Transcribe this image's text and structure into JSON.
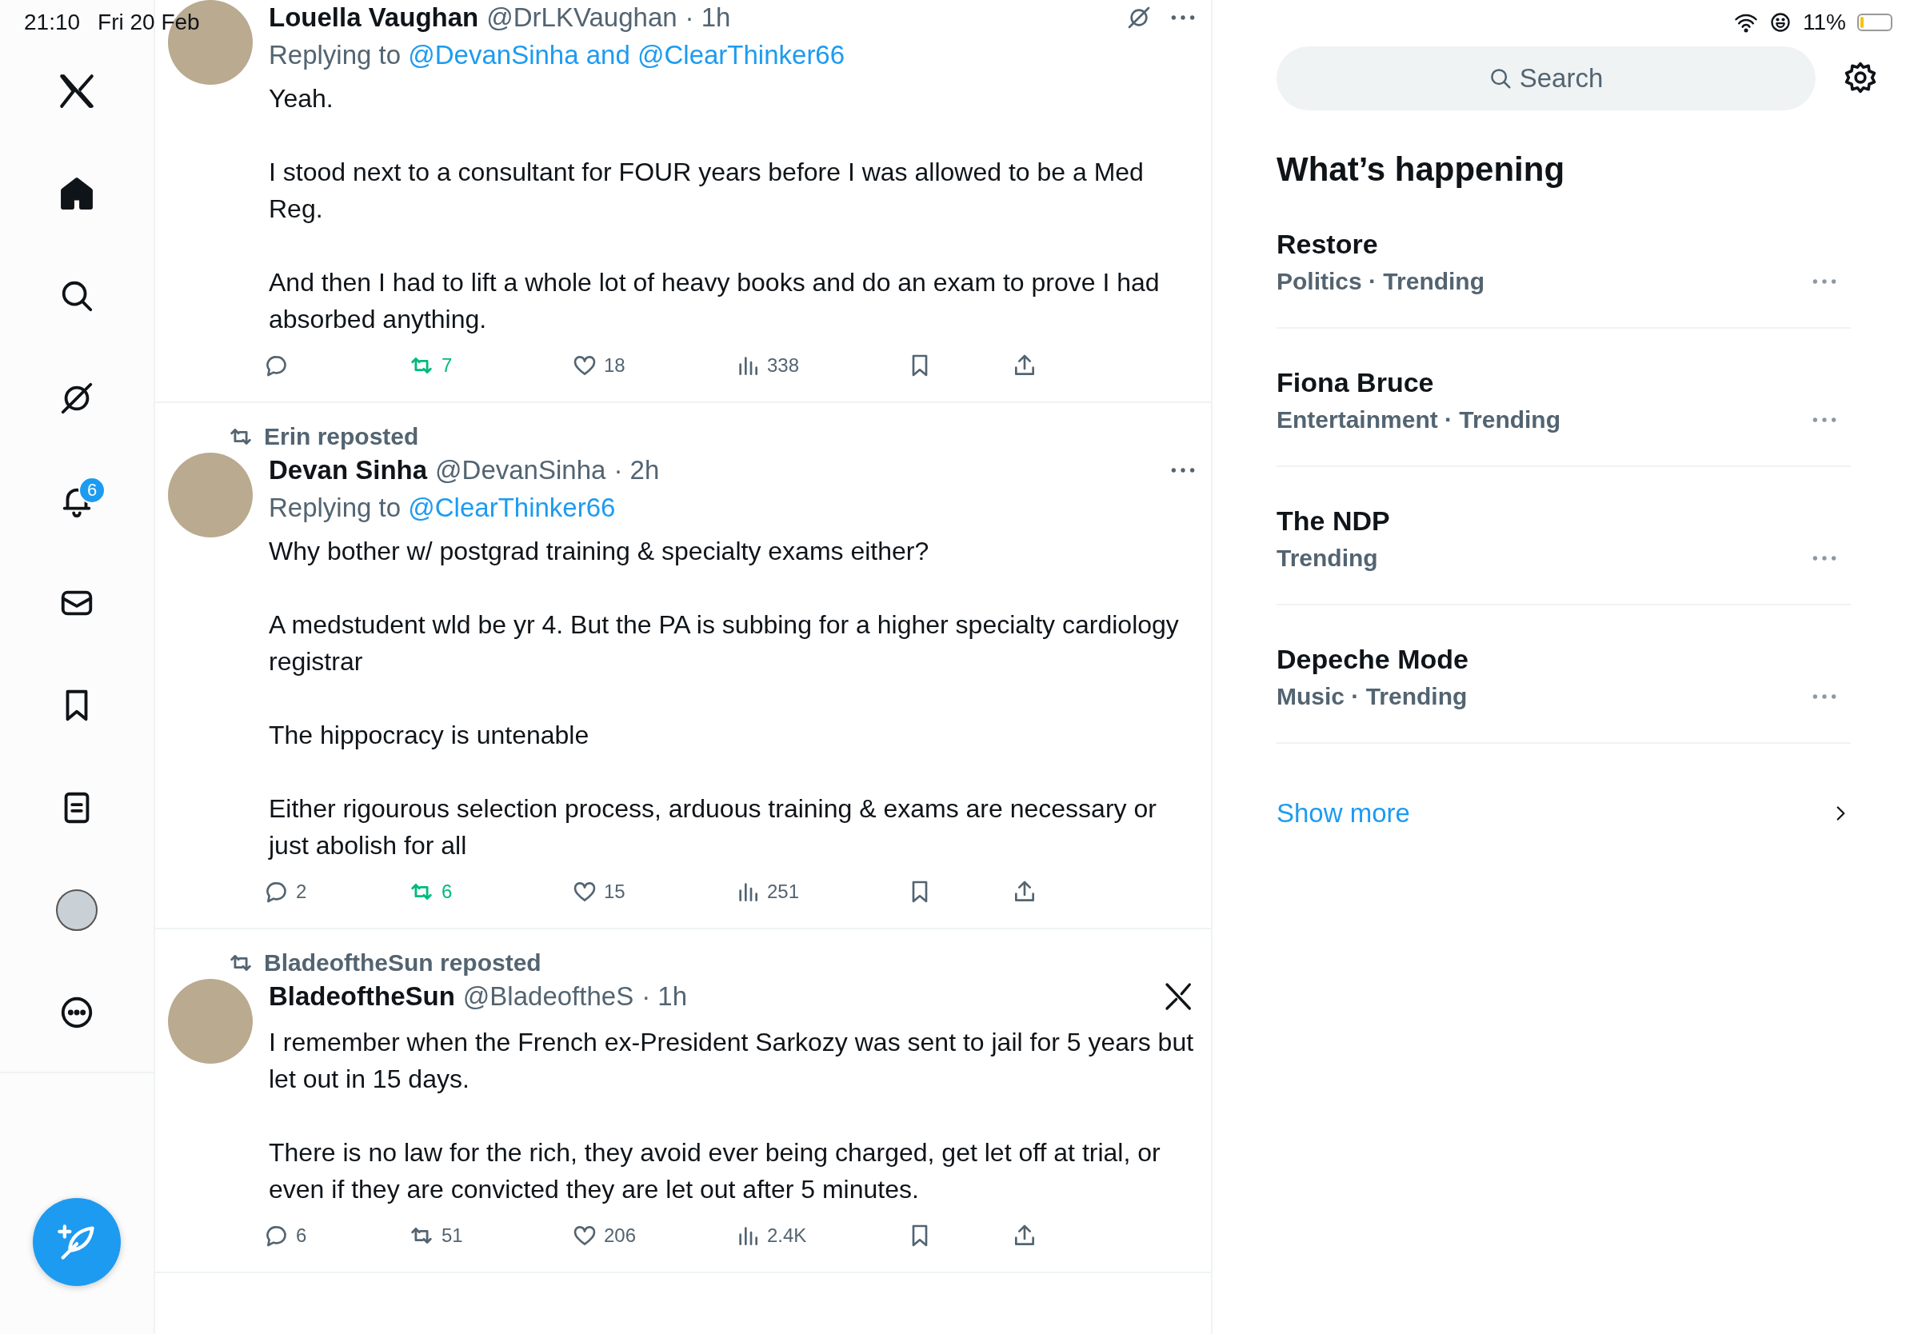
{
  "status_bar": {
    "time": "21:10",
    "date": "Fri 20 Feb",
    "battery": "11%"
  },
  "sidebar": {
    "items": [
      {
        "kind": "home",
        "selected": true
      },
      {
        "kind": "search",
        "selected": false
      },
      {
        "kind": "grok",
        "selected": false
      },
      {
        "kind": "notifications",
        "selected": false,
        "badge": "6"
      },
      {
        "kind": "messages",
        "selected": false
      },
      {
        "kind": "bookmarks",
        "selected": false
      },
      {
        "kind": "lists",
        "selected": false
      },
      {
        "kind": "profile",
        "selected": false
      },
      {
        "kind": "more",
        "selected": false
      }
    ]
  },
  "tweets": [
    {
      "name": "Louella Vaughan",
      "handle": "@DrLKVaughan",
      "time": "· 1h",
      "kind": "grok",
      "replying_label": "Replying to",
      "replying_to": "@DevanSinha and @ClearThinker66",
      "paragraphs": [
        "Yeah.",
        "I stood next to a consultant for FOUR years before I was allowed to be a Med Reg.",
        "And then I had to lift a whole lot of heavy books and do an exam to prove I had absorbed anything."
      ],
      "reposts": "7",
      "reposted": true,
      "likes": "18",
      "views": "338"
    },
    {
      "reposted_by": "Erin reposted",
      "name": "Devan Sinha",
      "handle": "@DevanSinha",
      "time": "· 2h",
      "kind": "more",
      "replying_label": "Replying to",
      "replying_to": "@ClearThinker66",
      "paragraphs": [
        "Why bother w/ postgrad training & specialty exams either?",
        "A medstudent wld be yr 4. But the PA is subbing for a higher specialty cardiology registrar",
        "The hippocracy is untenable",
        "Either rigourous selection process, arduous training & exams are necessary or just abolish for all"
      ],
      "replies": "2",
      "reposts": "6",
      "reposted": true,
      "likes": "15",
      "views": "251"
    },
    {
      "reposted_by": "BladeoftheSun reposted",
      "name": "BladeoftheSun",
      "handle": "@BladeoftheS",
      "time": "· 1h",
      "kind": "x",
      "paragraphs": [
        "I remember when the French ex-President Sarkozy was sent to jail for 5 years but let out in 15 days.",
        "There is no law for the rich, they avoid ever being charged, get let off at trial, or even if they are convicted they are let out after 5 minutes."
      ],
      "replies": "6",
      "reposts": "51",
      "reposted": false,
      "likes": "206",
      "views": "2.4K"
    }
  ],
  "search": {
    "placeholder": "Search"
  },
  "trends_panel": {
    "title": "What’s happening",
    "trends": [
      {
        "title": "Restore",
        "meta": "Politics · Trending"
      },
      {
        "title": "Fiona Bruce",
        "meta": "Entertainment · Trending"
      },
      {
        "title": "The NDP",
        "meta": "Trending"
      },
      {
        "title": "Depeche Mode",
        "meta": "Music · Trending"
      }
    ],
    "show_more": "Show more"
  }
}
